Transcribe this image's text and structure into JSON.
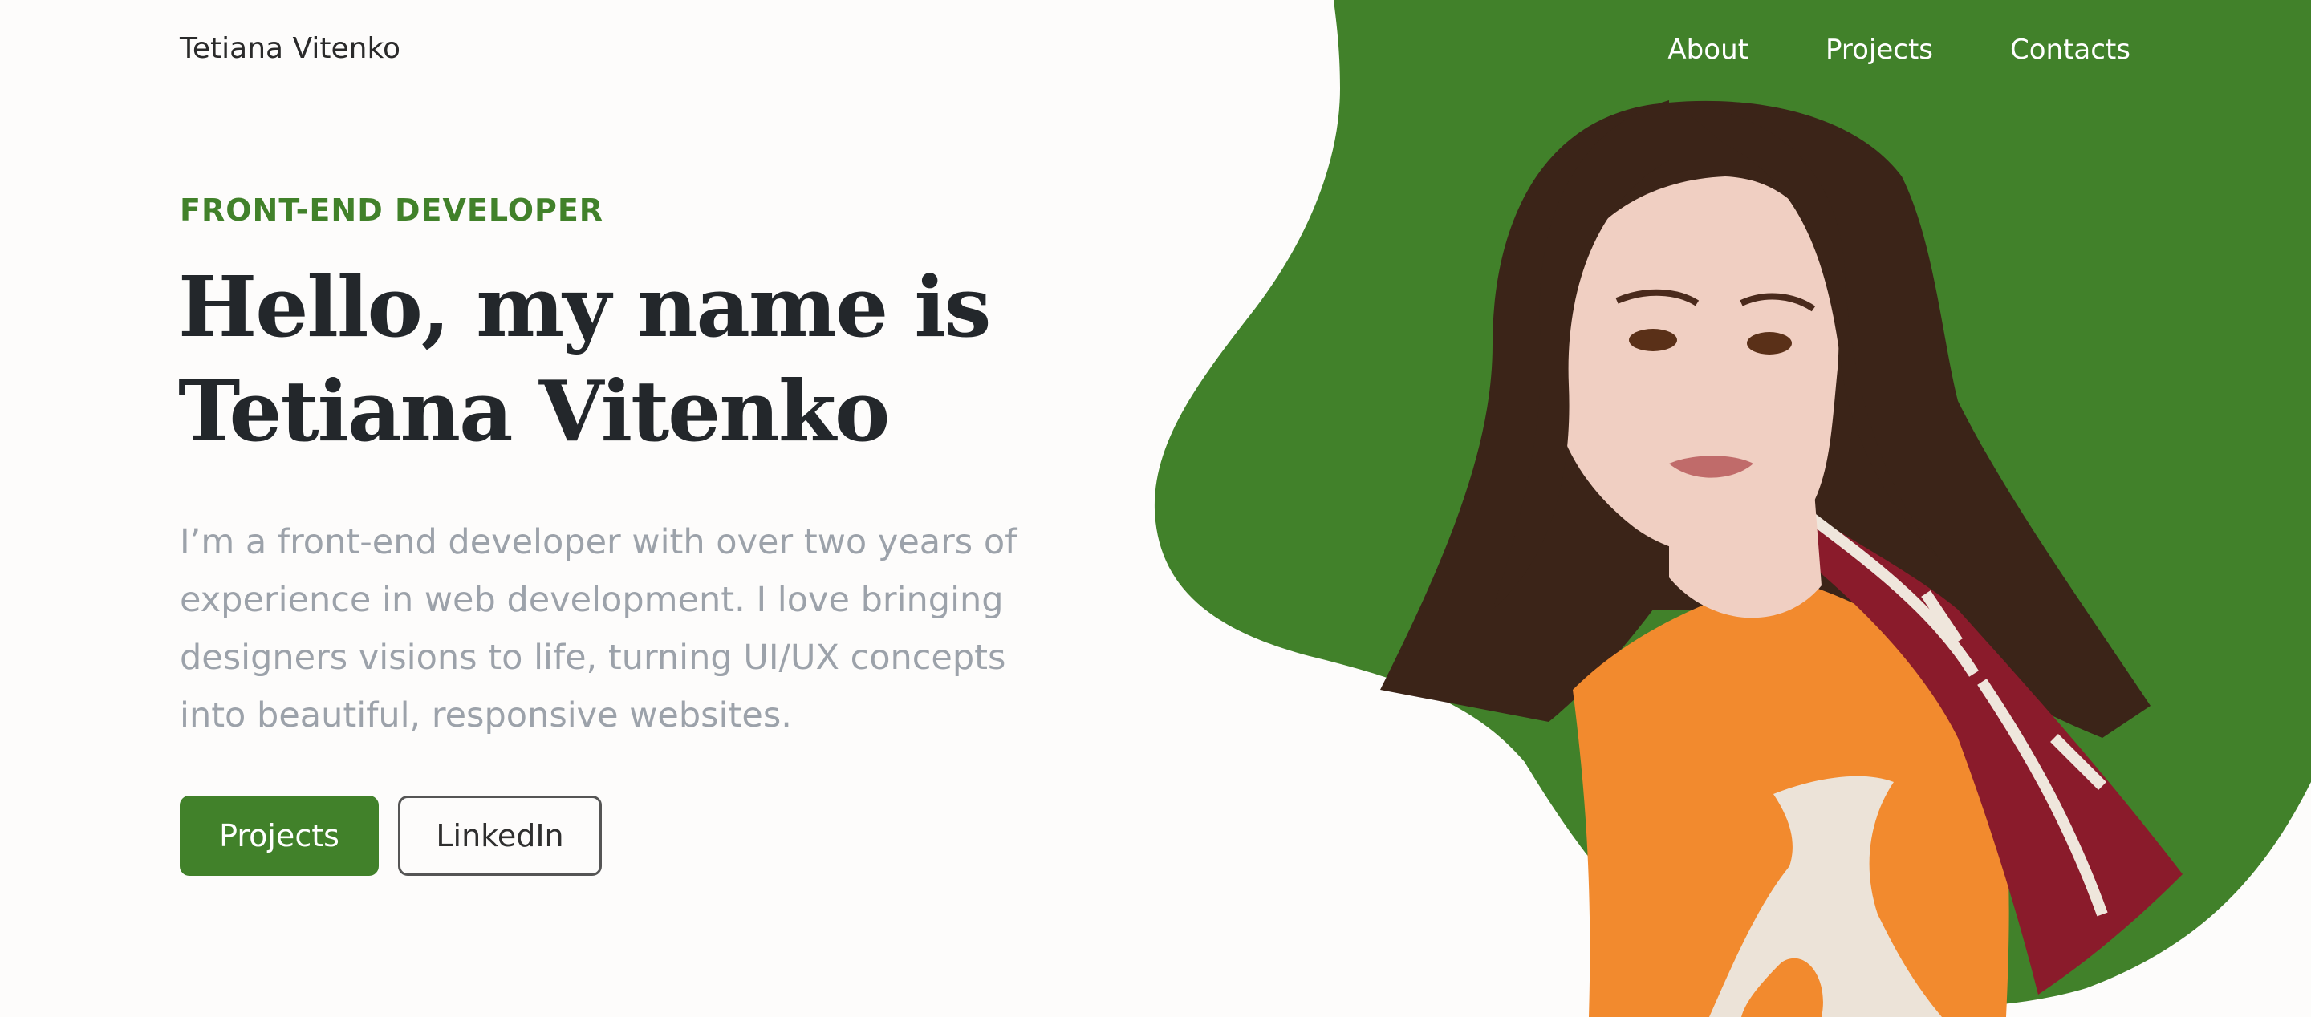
{
  "header": {
    "logo": "Tetiana Vitenko",
    "nav": [
      "About",
      "Projects",
      "Contacts"
    ]
  },
  "hero": {
    "eyebrow": "FRONT-END DEVELOPER",
    "headline_line1": "Hello, my name is",
    "headline_line2": "Tetiana Vitenko",
    "intro": "I’m a front-end developer with over two years of experience in web development. I love bringing designers visions to life, turning UI/UX concepts into beautiful, responsive websites.",
    "buttons": {
      "projects": "Projects",
      "linkedin": "LinkedIn"
    }
  },
  "colors": {
    "accent": "#41812a",
    "heading": "#23272b",
    "body_text": "#9ca2aa",
    "background": "#fdfcfb"
  },
  "portrait": "photo-of-tetiana-vitenko"
}
